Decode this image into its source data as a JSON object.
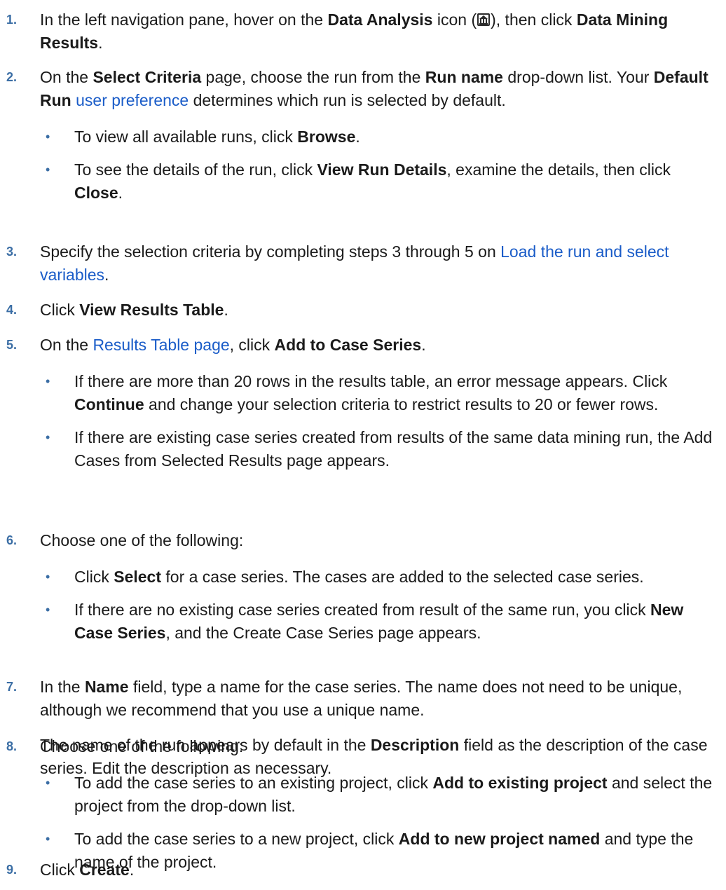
{
  "steps": [
    {
      "number": "1.",
      "prefix": "In the left navigation pane, hover on the ",
      "b1": "Data Analysis",
      "mid1": " icon (",
      "icon": "data-analysis-icon",
      "mid2": "), then click ",
      "b2": "Data Mining Results",
      "suffix": "."
    },
    {
      "number": "2.",
      "t1": "On the ",
      "b1": "Select Criteria",
      "t2": " page, choose the run from the ",
      "b2": "Run name",
      "t3": " drop-down list. Your ",
      "b3": "Default Run",
      "t4": " ",
      "link": "user preference",
      "t5": " determines which run is selected by default.",
      "bullets": [
        {
          "t1": "To view all available runs, click ",
          "b1": "Browse",
          "t2": "."
        },
        {
          "t1": "To see the details of the run, click ",
          "b1": "View Run Details",
          "t2": ", examine the details, then click ",
          "b2": "Close",
          "t3": "."
        }
      ]
    },
    {
      "number": "3.",
      "t1": "Specify the selection criteria by completing steps 3 through 5 on ",
      "link": "Load the run and select variables",
      "t2": "."
    },
    {
      "number": "4.",
      "t1": "Click ",
      "b1": "View Results Table",
      "t2": "."
    },
    {
      "number": "5.",
      "t1": "On the ",
      "link": "Results Table page",
      "t2": ", click ",
      "b1": "Add to Case Series",
      "t3": ".",
      "bullets": [
        {
          "t1": "If there are more than 20 rows in the results table, an error message appears. Click ",
          "b1": "Continue",
          "t2": " and change your selection criteria to restrict results to 20 or fewer rows."
        },
        {
          "t1": "If there are existing case series created from results of the same data mining run, the Add Cases from Selected Results page appears."
        }
      ]
    },
    {
      "number": "6.",
      "t1": "Choose one of the following:",
      "bullets": [
        {
          "t1": "Click ",
          "b1": "Select",
          "t2": " for a case series. The cases are added to the selected case series."
        },
        {
          "t1": "If there are no existing case series created from result of the same run, you click ",
          "b1": "New Case Series",
          "t2": ", and the Create Case Series page appears."
        }
      ]
    },
    {
      "number": "7.",
      "t1": "In the ",
      "b1": "Name",
      "t2": " field, type a name for the case series. The name does not need to be unique, although we recommend that you use a unique name.",
      "p2_t1": "The name of the run appears by default in the ",
      "p2_b1": "Description",
      "p2_t2": " field as the description of the case series. Edit the description as necessary."
    },
    {
      "number": "8.",
      "t1": "Choose one of the following:",
      "bullets": [
        {
          "t1": "To add the case series to an existing project, click ",
          "b1": "Add to existing project",
          "t2": " and select the project from the drop-down list."
        },
        {
          "t1": "To add the case series to a new project, click ",
          "b1": "Add to new project named",
          "t2": " and type the name of the project."
        }
      ]
    },
    {
      "number": "9.",
      "t1": "Click ",
      "b1": "Create",
      "t2": "."
    }
  ],
  "bullet_char": "•"
}
